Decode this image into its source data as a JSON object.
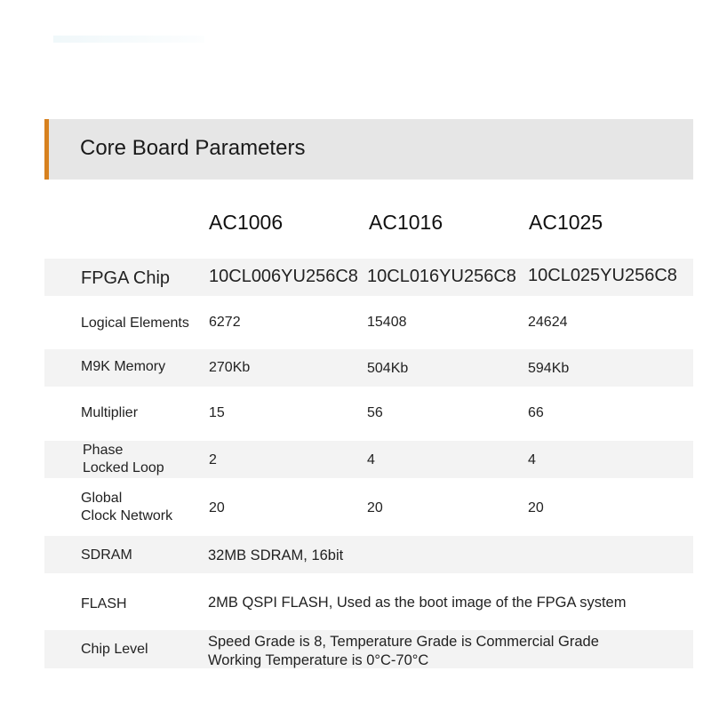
{
  "section": {
    "title": "Core Board Parameters",
    "accent_color": "#d7811f"
  },
  "models": [
    "AC1006",
    "AC1016",
    "AC1025"
  ],
  "rows": [
    {
      "label": "FPGA Chip",
      "values": [
        "10CL006YU256C8",
        "10CL016YU256C8",
        "10CL025YU256C8"
      ]
    },
    {
      "label": "Logical Elements",
      "values": [
        "6272",
        "15408",
        "24624"
      ]
    },
    {
      "label": "M9K Memory",
      "values": [
        "270Kb",
        "504Kb",
        "594Kb"
      ]
    },
    {
      "label": "Multiplier",
      "values": [
        "15",
        "56",
        "66"
      ]
    },
    {
      "label_lines": [
        "Phase",
        "Locked Loop"
      ],
      "values": [
        "2",
        "4",
        "4"
      ]
    },
    {
      "label_lines": [
        "Global",
        "Clock Network"
      ],
      "values": [
        "20",
        "20",
        "20"
      ]
    },
    {
      "label": "SDRAM",
      "value": "32MB SDRAM, 16bit"
    },
    {
      "label": "FLASH",
      "value": "2MB QSPI FLASH,  Used as the boot image of the FPGA system"
    },
    {
      "label": "Chip Level",
      "value_lines": [
        "Speed Grade is 8, Temperature Grade is Commercial Grade",
        "Working Temperature is 0°C-70°C"
      ]
    }
  ]
}
